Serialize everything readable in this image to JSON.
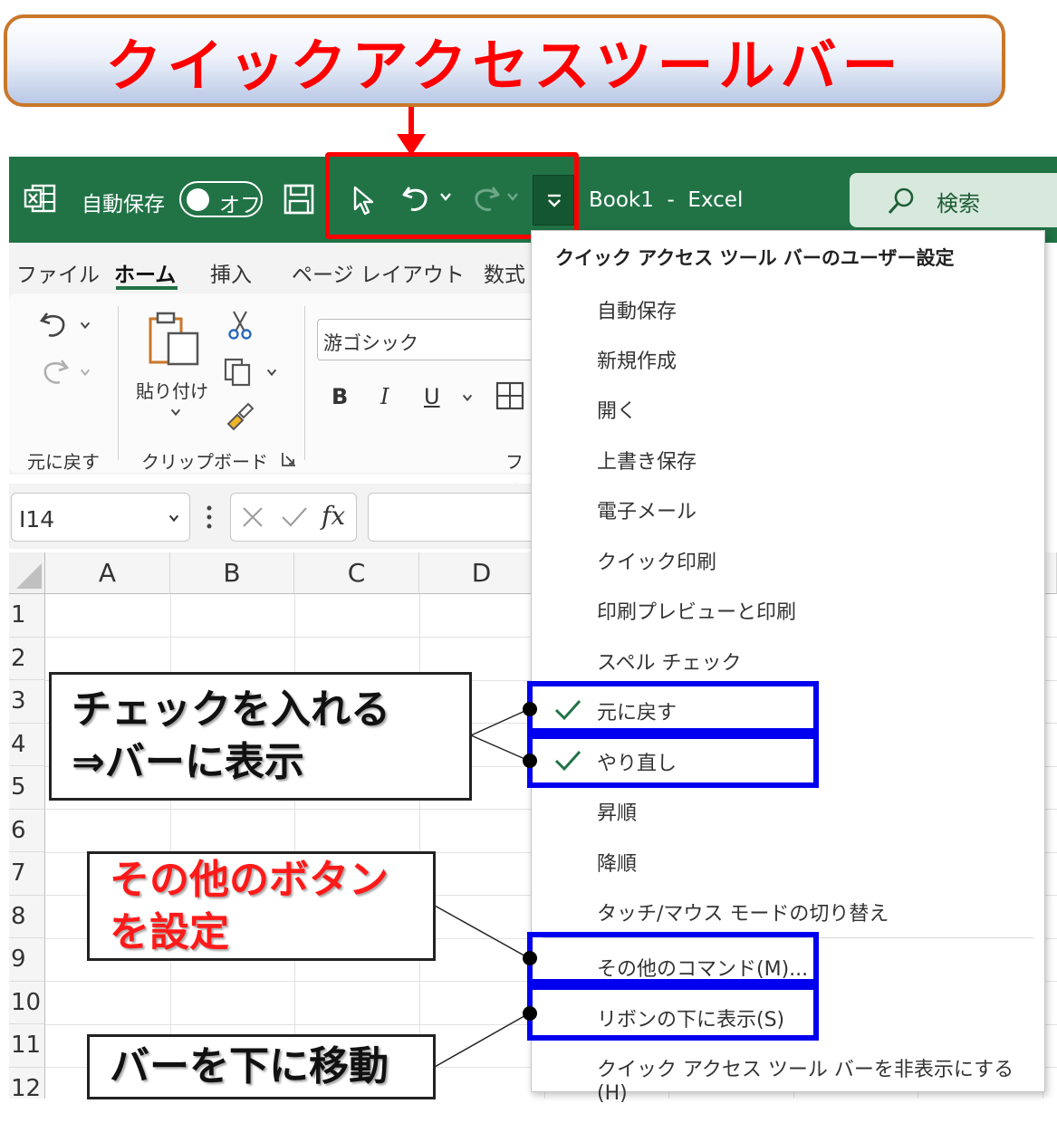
{
  "banner": {
    "title": "クイックアクセスツールバー"
  },
  "titlebar": {
    "autosave_label": "自動保存",
    "toggle_state": "オフ",
    "document_title": "Book1  -  Excel",
    "search_placeholder": "検索"
  },
  "ribbon": {
    "tabs": [
      "ファイル",
      "ホーム",
      "挿入",
      "ページ レイアウト",
      "数式"
    ],
    "groups": {
      "undo_group": "元に戻す",
      "clipboard_group": "クリップボード",
      "paste_label": "貼り付け",
      "font_group_partial": "フォ"
    },
    "font_name": "游ゴシック",
    "format_buttons": [
      "B",
      "I",
      "U"
    ]
  },
  "formula_bar": {
    "name_box": "I14",
    "fx_label": "fx"
  },
  "grid": {
    "columns": [
      "A",
      "B",
      "C",
      "D"
    ],
    "rows": [
      "1",
      "2",
      "3",
      "4",
      "5",
      "6",
      "7",
      "8",
      "9",
      "10",
      "11",
      "12"
    ]
  },
  "menu": {
    "header": "クイック アクセス ツール バーのユーザー設定",
    "items": [
      {
        "label": "自動保存",
        "checked": false
      },
      {
        "label": "新規作成",
        "checked": false
      },
      {
        "label": "開く",
        "checked": false
      },
      {
        "label": "上書き保存",
        "checked": false
      },
      {
        "label": "電子メール",
        "checked": false
      },
      {
        "label": "クイック印刷",
        "checked": false
      },
      {
        "label": "印刷プレビューと印刷",
        "checked": false
      },
      {
        "label": "スペル チェック",
        "checked": false
      },
      {
        "label": "元に戻す",
        "checked": true
      },
      {
        "label": "やり直し",
        "checked": true
      },
      {
        "label": "昇順",
        "checked": false
      },
      {
        "label": "降順",
        "checked": false
      },
      {
        "label": "タッチ/マウス モードの切り替え",
        "checked": false
      }
    ],
    "more_commands": "その他のコマンド(M)...",
    "show_below": "リボンの下に表示(S)",
    "hide_qat": "クイック アクセス ツール バーを非表示にする (H)"
  },
  "callouts": {
    "check_line1": "チェックを入れる",
    "check_line2": "⇒バーに表示",
    "other_line1": "その他のボタン",
    "other_line2": "を設定",
    "move": "バーを下に移動"
  },
  "colors": {
    "excel_green": "#217346",
    "highlight_red": "#ff0000",
    "highlight_blue": "#0000ee",
    "check_green": "#217346"
  }
}
